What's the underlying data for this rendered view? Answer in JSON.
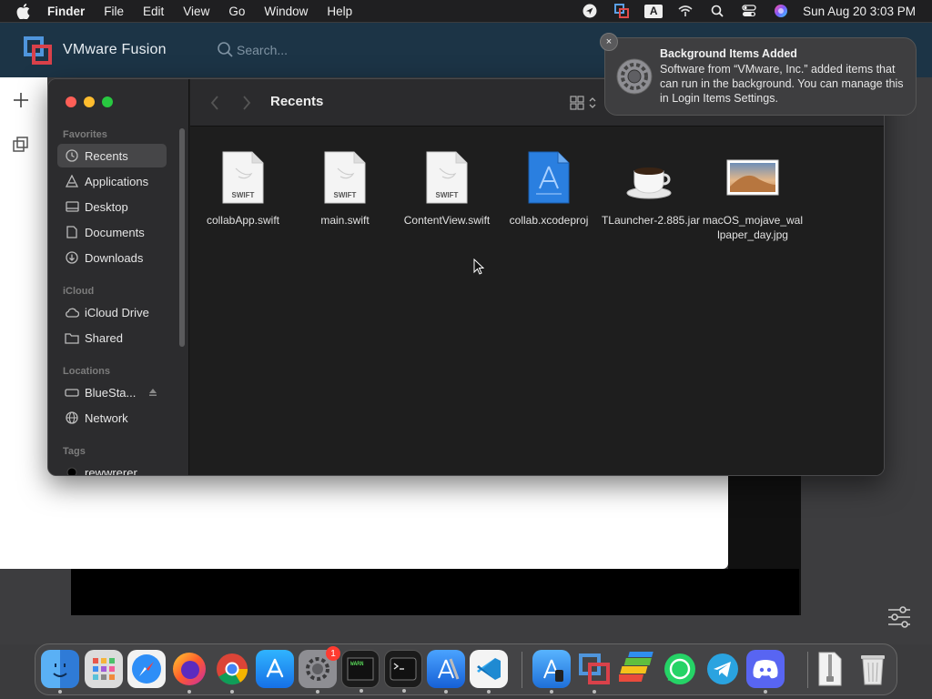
{
  "menubar": {
    "items": [
      "Finder",
      "File",
      "Edit",
      "View",
      "Go",
      "Window",
      "Help"
    ],
    "status_icons": [
      "location-arrow-icon",
      "vmware-status-icon",
      "input-source-a-icon",
      "wifi-icon",
      "search-icon",
      "control-center-icon",
      "siri-icon"
    ],
    "input_source": "A",
    "clock": "Sun Aug 20  3:03 PM"
  },
  "vmware": {
    "title": "VMware Fusion",
    "search_placeholder": "Search..."
  },
  "finder": {
    "title": "Recents",
    "sidebar": {
      "favorites_header": "Favorites",
      "favorites": [
        "Recents",
        "Applications",
        "Desktop",
        "Documents",
        "Downloads"
      ],
      "icloud_header": "iCloud",
      "icloud": [
        "iCloud Drive",
        "Shared"
      ],
      "locations_header": "Locations",
      "locations": [
        "BlueSta...",
        "Network"
      ],
      "tags_header": "Tags",
      "tags": [
        "rewwrerer"
      ]
    },
    "files": [
      {
        "name": "collabApp.swift",
        "type": "swift",
        "label": "SWIFT"
      },
      {
        "name": "main.swift",
        "type": "swift",
        "label": "SWIFT"
      },
      {
        "name": "ContentView.swift",
        "type": "swift",
        "label": "SWIFT"
      },
      {
        "name": "collab.xcodeproj",
        "type": "xcodeproj",
        "label": ""
      },
      {
        "name": "TLauncher-2.885.jar",
        "type": "jar",
        "label": ""
      },
      {
        "name": "macOS_mojave_wallpaper_day.jpg",
        "type": "jpg",
        "label": ""
      }
    ]
  },
  "notification": {
    "title": "Background Items Added",
    "body": "Software from “VMware, Inc.” added items that can run in the background. You can manage this in Login Items Settings.",
    "close": "×"
  },
  "dock": {
    "apps": [
      "Finder",
      "Launchpad",
      "Safari",
      "Firefox",
      "Chrome",
      "App Store",
      "System Settings",
      "Console",
      "Terminal",
      "Xcode",
      "Visual Studio Code",
      "Simulator",
      "VMware Fusion",
      "BlueStacks",
      "WhatsApp",
      "Telegram",
      "Discord",
      "Archive Utility",
      "Trash"
    ],
    "settings_badge": "1"
  },
  "colors": {
    "vmware_header": "#1c3446",
    "finder_sidebar": "#2c2c2e",
    "finder_content": "#1e1e1e",
    "selection": "#464648",
    "notification_bg": "#3e3e40"
  }
}
